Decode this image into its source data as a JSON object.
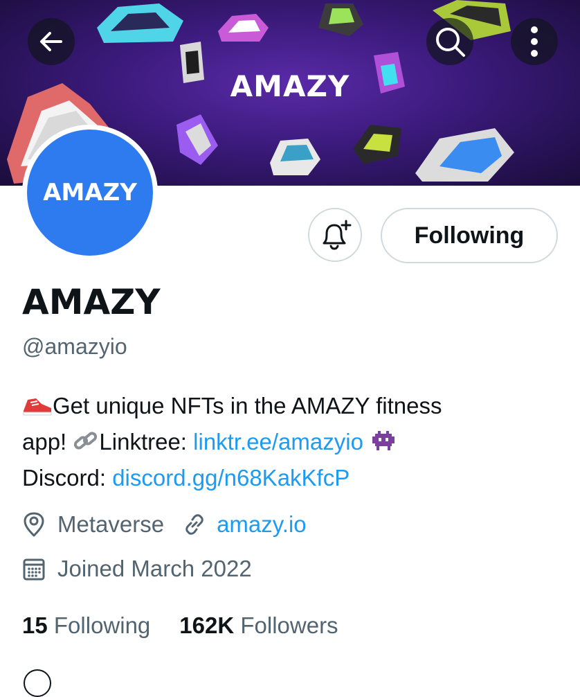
{
  "banner": {
    "title": "AMAZY",
    "colors": {
      "bg_center": "#5a2aa8",
      "bg_edge": "#1a0c3a"
    }
  },
  "header": {
    "back_icon": "arrow-left-icon",
    "search_icon": "search-icon",
    "more_icon": "more-vertical-icon"
  },
  "avatar": {
    "text": "AMAZY",
    "color": "#2e7bf0"
  },
  "actions": {
    "notify_icon": "bell-plus-icon",
    "follow_label": "Following"
  },
  "profile": {
    "name": "AMAZY",
    "handle": "@amazyio",
    "bio": {
      "line1_emoji": "sneaker-emoji",
      "line1_text": "Get unique NFTs in the AMAZY fitness",
      "line2_prefix": "app! ",
      "line2_link_emoji": "link-emoji",
      "line2_label": "Linktree: ",
      "line2_link": "linktr.ee/amazyio",
      "line2_emoji": "alien-monster-emoji",
      "line3_label": "Discord: ",
      "line3_link": "discord.gg/n68KakKfcP"
    },
    "location": "Metaverse",
    "website": "amazy.io",
    "joined": "Joined March 2022"
  },
  "stats": {
    "following_count": "15",
    "following_label": "Following",
    "followers_count": "162K",
    "followers_label": "Followers"
  },
  "colors": {
    "accent": "#1d9bf0",
    "muted": "#536471",
    "text": "#0f1419"
  }
}
